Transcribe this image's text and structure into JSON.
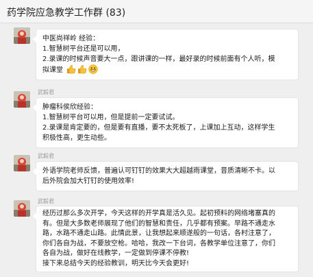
{
  "header": {
    "title": "药学院应急教学工作群 (83)"
  },
  "messages": [
    {
      "sender": "",
      "lines": [
        "中医尚祥岭 经验：",
        "1.智慧树平台还是可以用，",
        "2.录课的时候声音要大一点，跟讲课的一样，最好录的时候前面有个人听，模",
        "拟课堂"
      ],
      "emojis": [
        "thumbs-up-icon",
        "thumbs-up-icon",
        "grinning-face-icon"
      ]
    },
    {
      "sender": "武毅君",
      "lines": [
        "肿瘤科侯欣经验：",
        "1.智慧树平台可以用，但是提前一定要试试。",
        "2.录课是肯定要的，但是要有直播，要不太死板了，上课加上互动，这样学生",
        "积极性高，更生动些。"
      ]
    },
    {
      "sender": "武毅君",
      "lines": [
        "外语学院老师反馈，普遍认可钉钉的效果大大超越雨课堂，音质清晰不卡。以",
        "后外院会加大钉钉的使用效率!"
      ]
    },
    {
      "sender": "武毅君",
      "lines": [
        "经历过那么多次开学，今天这样的开学真是活久见。起初预料的网络堵塞真的",
        "有。但是大多数老师展现了他们的智慧和责任，几乎都有预案。早路不通走水",
        "路，水路不通走山路。此情此景，让我想起来顺遂般的一句话，各村注意了，",
        "你们各自为战，不要放空枪。哈哈，我改一下台词，各教学单位注意了，你们",
        "各自为战，做好在线教学，一定做到停课不停教!",
        "接下来总结今天的经验教训，明天比今天会更好!"
      ]
    }
  ],
  "colors": {
    "background": "#efefef",
    "bubble": "#ffffff",
    "sender_text": "#9a9a9a"
  }
}
